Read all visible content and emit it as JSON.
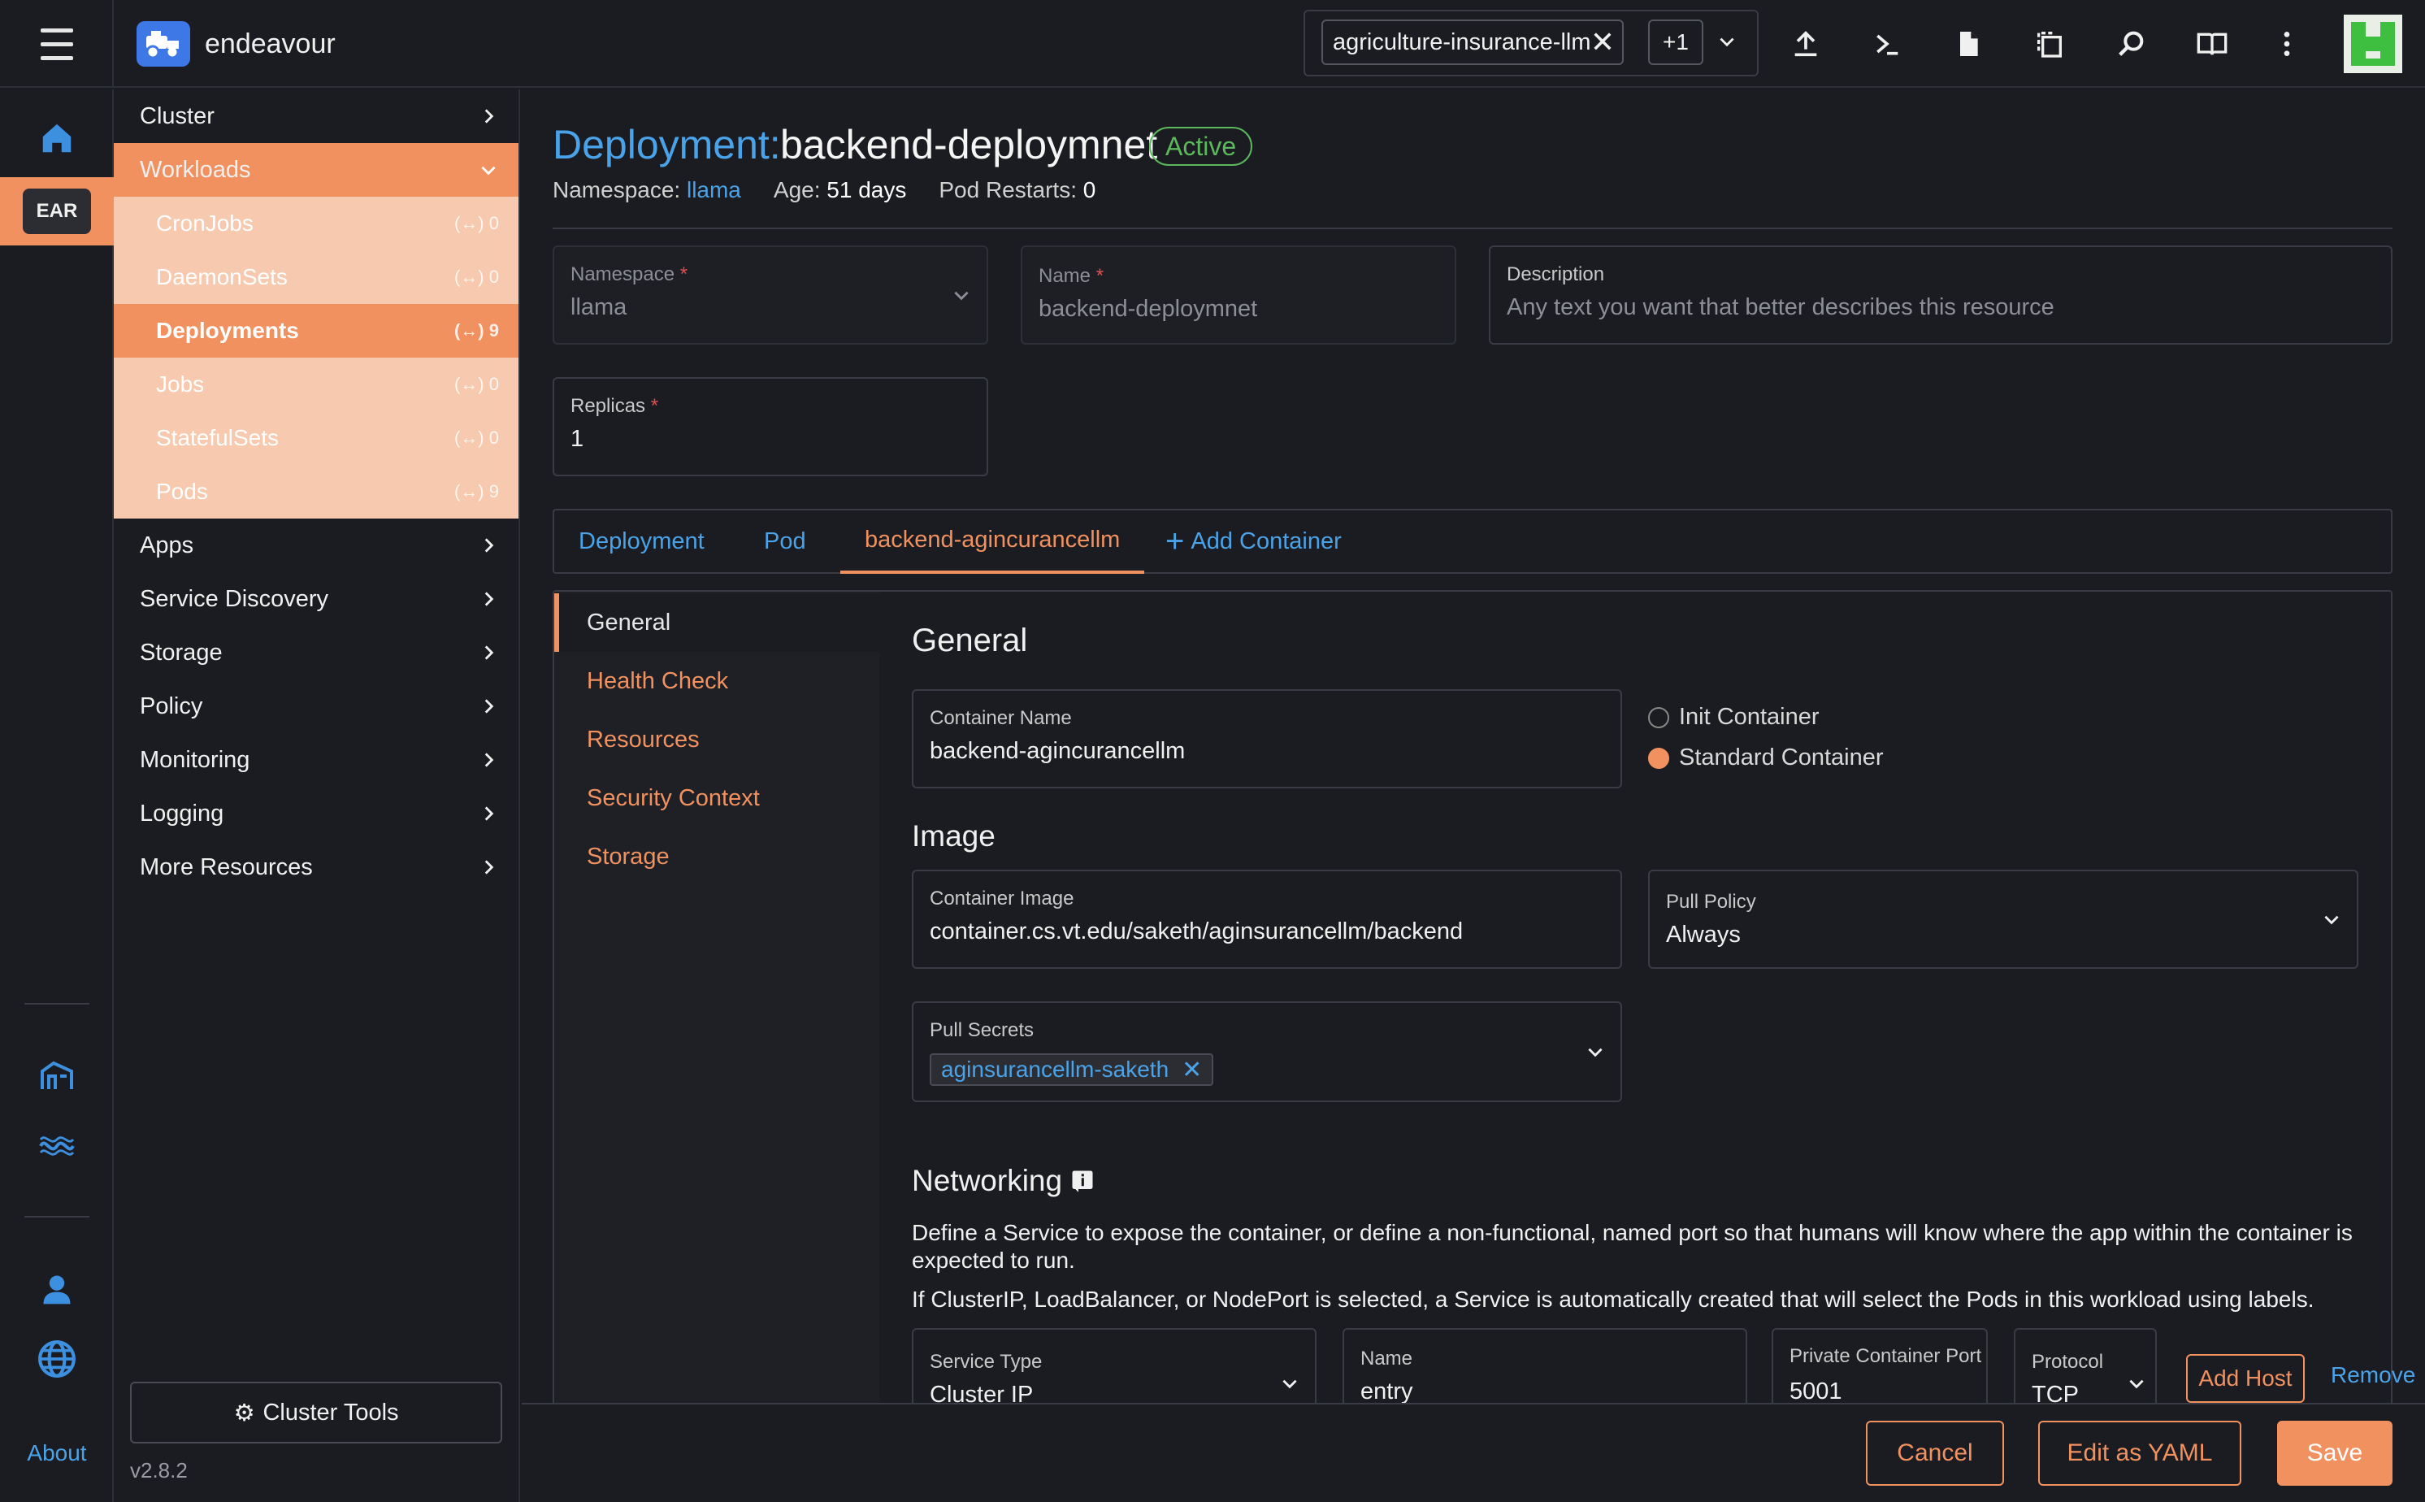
{
  "header": {
    "app_name": "endeavour",
    "context_chip": "agriculture-insurance-llm",
    "context_more": "+1"
  },
  "rail": {
    "cluster_badge": "EAR",
    "about": "About"
  },
  "sidenav": {
    "items": [
      {
        "label": "Cluster"
      },
      {
        "label": "Workloads"
      },
      {
        "label": "Apps"
      },
      {
        "label": "Service Discovery"
      },
      {
        "label": "Storage"
      },
      {
        "label": "Policy"
      },
      {
        "label": "Monitoring"
      },
      {
        "label": "Logging"
      },
      {
        "label": "More Resources"
      }
    ],
    "workloads": [
      {
        "label": "CronJobs",
        "count": "0"
      },
      {
        "label": "DaemonSets",
        "count": "0"
      },
      {
        "label": "Deployments",
        "count": "9"
      },
      {
        "label": "Jobs",
        "count": "0"
      },
      {
        "label": "StatefulSets",
        "count": "0"
      },
      {
        "label": "Pods",
        "count": "9"
      }
    ],
    "cluster_tools": "Cluster Tools",
    "version": "v2.8.2"
  },
  "page": {
    "title_prefix": "Deployment:",
    "title_name": "backend-deploymnet",
    "status": "Active",
    "namespace_label": "Namespace:",
    "namespace_value": "llama",
    "age_label": "Age:",
    "age_value": "51 days",
    "restarts_label": "Pod Restarts:",
    "restarts_value": "0"
  },
  "form": {
    "namespace": {
      "label": "Namespace",
      "value": "llama"
    },
    "name": {
      "label": "Name",
      "value": "backend-deploymnet"
    },
    "description": {
      "label": "Description",
      "placeholder": "Any text you want that better describes this resource"
    },
    "replicas": {
      "label": "Replicas",
      "value": "1"
    }
  },
  "tabs": [
    {
      "label": "Deployment"
    },
    {
      "label": "Pod"
    },
    {
      "label": "backend-agincurancellm"
    },
    {
      "label": "Add Container"
    }
  ],
  "container_nav": [
    {
      "label": "General"
    },
    {
      "label": "Health Check"
    },
    {
      "label": "Resources"
    },
    {
      "label": "Security Context"
    },
    {
      "label": "Storage"
    }
  ],
  "general": {
    "heading": "General",
    "container_name_label": "Container Name",
    "container_name": "backend-agincurancellm",
    "init_container": "Init Container",
    "standard_container": "Standard Container",
    "image_heading": "Image",
    "container_image_label": "Container Image",
    "container_image": "container.cs.vt.edu/saketh/aginsurancellm/backend",
    "pull_policy_label": "Pull Policy",
    "pull_policy": "Always",
    "pull_secrets_label": "Pull Secrets",
    "pull_secret": "aginsurancellm-saketh"
  },
  "networking": {
    "heading": "Networking",
    "para1": "Define a Service to expose the container, or define a non-functional, named port so that humans will know where the app within the container is expected to run.",
    "para2": "If ClusterIP, LoadBalancer, or NodePort is selected, a Service is automatically created that will select the Pods in this workload using labels.",
    "service_type_label": "Service Type",
    "service_type": "Cluster IP",
    "name_label": "Name",
    "name": "entry",
    "port_label": "Private Container Port",
    "port": "5001",
    "protocol_label": "Protocol",
    "protocol": "TCP",
    "add_host": "Add Host",
    "remove": "Remove"
  },
  "footer": {
    "cancel": "Cancel",
    "edit_yaml": "Edit as YAML",
    "save": "Save"
  },
  "colors": {
    "accent": "#f0915f",
    "link": "#4aa3e8",
    "active": "#5cb85c",
    "background": "#1b1c21"
  }
}
